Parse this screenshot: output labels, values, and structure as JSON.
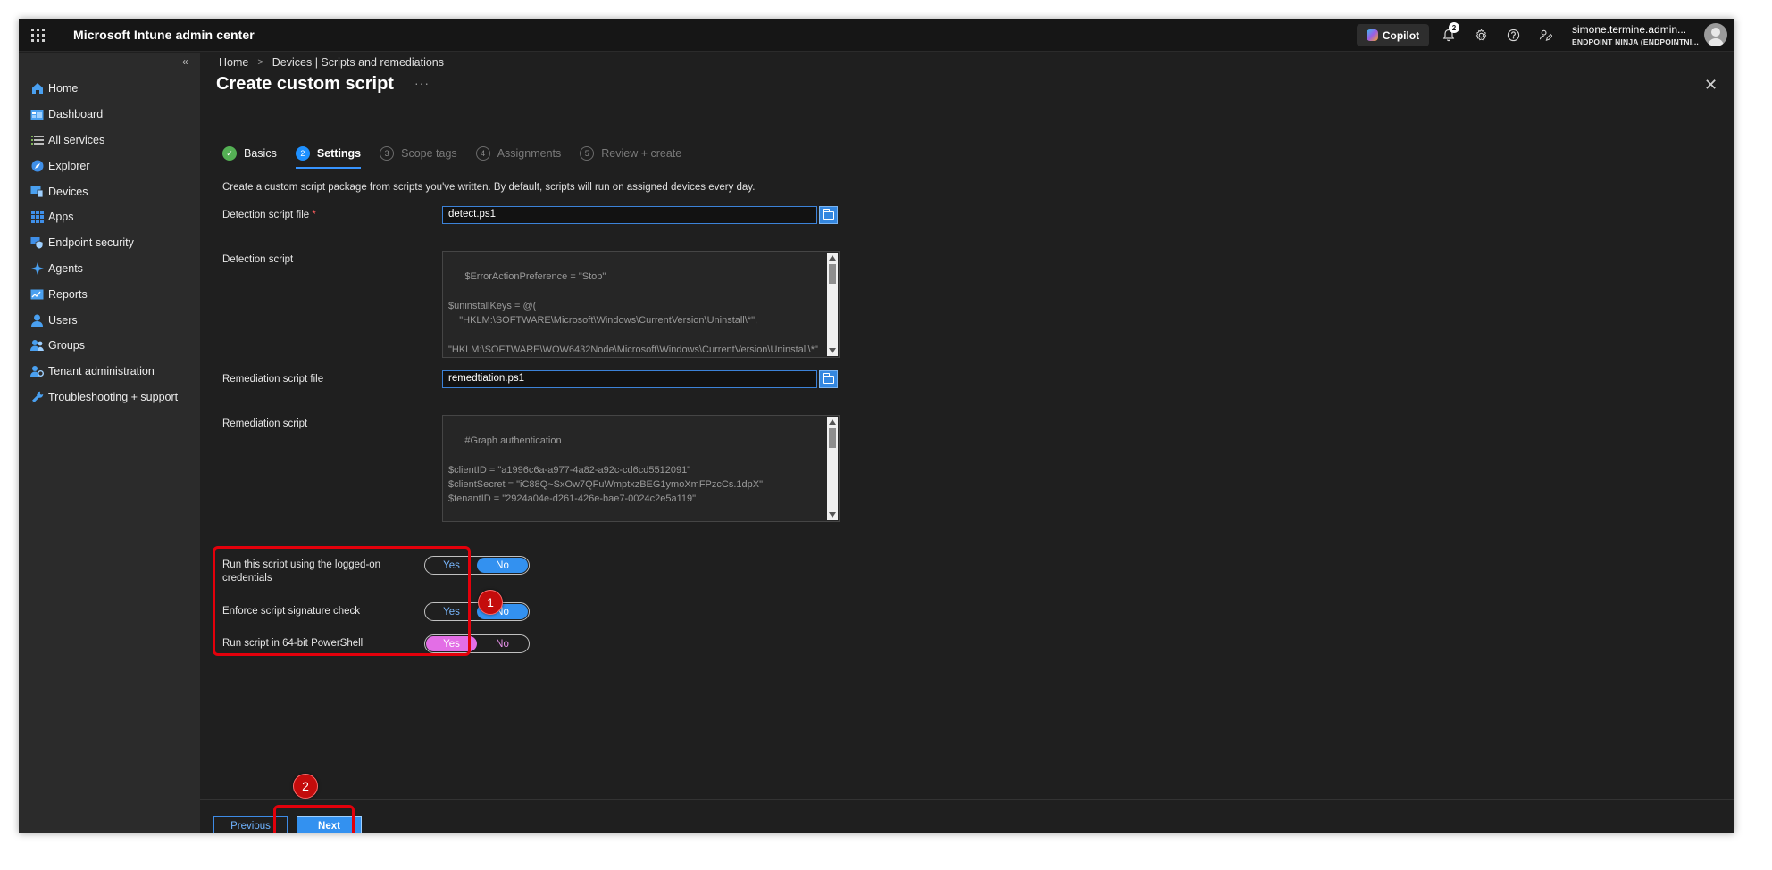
{
  "app": {
    "title": "Microsoft Intune admin center"
  },
  "topbar": {
    "copilot_label": "Copilot",
    "notification_count": "2",
    "user_name": "simone.termine.admin...",
    "user_tenant": "ENDPOINT NINJA (ENDPOINTNI..."
  },
  "sidebar": {
    "collapse_glyph": "«",
    "items": [
      {
        "label": "Home",
        "icon": "home-icon",
        "color": "#4aa0f0"
      },
      {
        "label": "Dashboard",
        "icon": "dashboard-icon",
        "color": "#4aa0f0"
      },
      {
        "label": "All services",
        "icon": "list-icon",
        "color": "#7fb35a"
      },
      {
        "label": "Explorer",
        "icon": "explorer-icon",
        "color": "#3f8fe8"
      },
      {
        "label": "Devices",
        "icon": "devices-icon",
        "color": "#4aa0f0"
      },
      {
        "label": "Apps",
        "icon": "apps-icon",
        "color": "#3f8fe8"
      },
      {
        "label": "Endpoint security",
        "icon": "shield-icon",
        "color": "#3f8fe8"
      },
      {
        "label": "Agents",
        "icon": "agents-icon",
        "color": "#4aa0f0"
      },
      {
        "label": "Reports",
        "icon": "reports-icon",
        "color": "#4aa0f0"
      },
      {
        "label": "Users",
        "icon": "user-icon",
        "color": "#4aa0f0"
      },
      {
        "label": "Groups",
        "icon": "groups-icon",
        "color": "#4aa0f0"
      },
      {
        "label": "Tenant administration",
        "icon": "tenant-admin-icon",
        "color": "#4aa0f0"
      },
      {
        "label": "Troubleshooting + support",
        "icon": "wrench-icon",
        "color": "#4aa0f0"
      }
    ]
  },
  "breadcrumb": {
    "home": "Home",
    "current": "Devices | Scripts and remediations",
    "separator": ">"
  },
  "page": {
    "title": "Create custom script",
    "more": "···",
    "close": "✕",
    "intro": "Create a custom script package from scripts you've written. By default, scripts will run on assigned devices every day."
  },
  "steps": [
    {
      "num": "✓",
      "label": "Basics",
      "state": "done"
    },
    {
      "num": "2",
      "label": "Settings",
      "state": "active"
    },
    {
      "num": "3",
      "label": "Scope tags",
      "state": "todo"
    },
    {
      "num": "4",
      "label": "Assignments",
      "state": "todo"
    },
    {
      "num": "5",
      "label": "Review + create",
      "state": "todo"
    }
  ],
  "form": {
    "detection_file_label": "Detection script file",
    "required_mark": "*",
    "detection_file_value": "detect.ps1",
    "detection_script_label": "Detection script",
    "detection_script_text": "$ErrorActionPreference = \"Stop\"\n\n$uninstallKeys = @(\n    \"HKLM:\\SOFTWARE\\Microsoft\\Windows\\CurrentVersion\\Uninstall\\*\",\n\n\"HKLM:\\SOFTWARE\\WOW6432Node\\Microsoft\\Windows\\CurrentVersion\\Uninstall\\*\"",
    "remediation_file_label": "Remediation script file",
    "remediation_file_value": "remedtiation.ps1",
    "remediation_script_label": "Remediation script",
    "remediation_script_text": "#Graph authentication\n\n$clientID = \"a1996c6a-a977-4a82-a92c-cd6cd5512091\"\n$clientSecret = \"iC88Q~SxOw7QFuWmptxzBEG1ymoXmFPzcCs.1dpX\"\n$tenantID = \"2924a04e-d261-426e-bae7-0024c2e5a119\"\n\n#Assemble the token",
    "toggles": [
      {
        "label": "Run this script using the logged-on credentials",
        "yes": "Yes",
        "no": "No",
        "selected": "No"
      },
      {
        "label": "Enforce script signature check",
        "yes": "Yes",
        "no": "No",
        "selected": "No"
      },
      {
        "label": "Run script in 64-bit PowerShell",
        "yes": "Yes",
        "no": "No",
        "selected": "Yes"
      }
    ]
  },
  "callouts": [
    {
      "num": "1"
    },
    {
      "num": "2"
    }
  ],
  "footer": {
    "previous": "Previous",
    "next": "Next"
  },
  "colors": {
    "accent": "#3391f0",
    "callout": "#e3000b",
    "toggle_pink": "#e36ee6"
  }
}
